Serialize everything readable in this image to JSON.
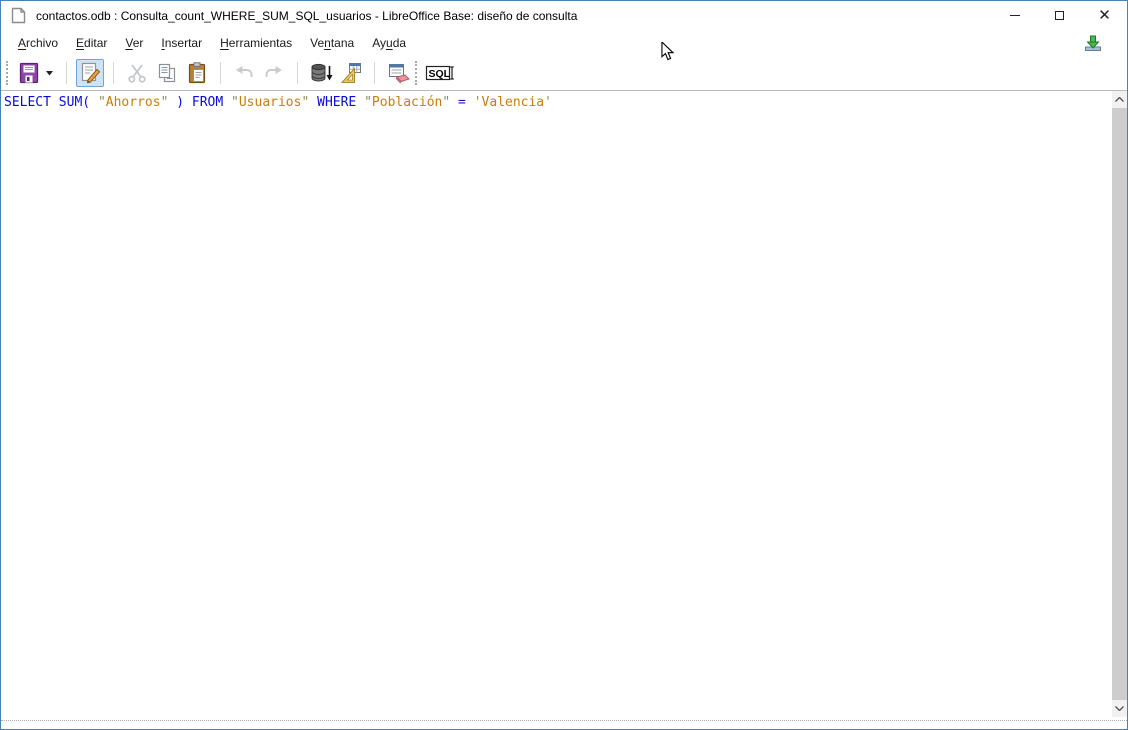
{
  "window": {
    "title": "contactos.odb : Consulta_count_WHERE_SUM_SQL_usuarios - LibreOffice Base: diseño de consulta",
    "app_icon": "libreoffice-document-icon",
    "controls": [
      {
        "id": "minimize",
        "icon": "minimize-icon"
      },
      {
        "id": "maximize",
        "icon": "maximize-icon"
      },
      {
        "id": "close",
        "icon": "close-icon"
      }
    ]
  },
  "menubar": {
    "items": [
      {
        "id": "archivo",
        "label": "Archivo",
        "underline": 0
      },
      {
        "id": "editar",
        "label": "Editar",
        "underline": 0
      },
      {
        "id": "ver",
        "label": "Ver",
        "underline": 0
      },
      {
        "id": "insertar",
        "label": "Insertar",
        "underline": 0
      },
      {
        "id": "herramientas",
        "label": "Herramientas",
        "underline": 0
      },
      {
        "id": "ventana",
        "label": "Ventana",
        "underline": 2
      },
      {
        "id": "ayuda",
        "label": "Ayuda",
        "underline": 2
      }
    ],
    "right_icon": "green-download-tray-icon"
  },
  "toolbar": {
    "buttons": [
      {
        "id": "save",
        "icon": "floppy-disk-icon",
        "state": "enabled"
      },
      {
        "id": "save-dropdown",
        "icon": "chevron-down-icon",
        "state": "enabled"
      },
      {
        "id": "edit-design-toggle",
        "icon": "document-pencil-icon",
        "state": "active"
      },
      {
        "id": "cut",
        "icon": "scissors-icon",
        "state": "disabled"
      },
      {
        "id": "copy",
        "icon": "copy-pages-icon",
        "state": "enabled"
      },
      {
        "id": "paste",
        "icon": "clipboard-paste-icon",
        "state": "enabled"
      },
      {
        "id": "undo",
        "icon": "undo-arrow-icon",
        "state": "disabled"
      },
      {
        "id": "redo",
        "icon": "redo-arrow-icon",
        "state": "disabled"
      },
      {
        "id": "run-query",
        "icon": "database-run-icon",
        "state": "enabled"
      },
      {
        "id": "switch-design-view",
        "icon": "set-square-table-icon",
        "state": "enabled"
      },
      {
        "id": "clear-query",
        "icon": "eraser-window-icon",
        "state": "enabled"
      },
      {
        "id": "run-sql-direct",
        "icon": "sql-icon",
        "state": "enabled"
      }
    ]
  },
  "sql_editor": {
    "statement": "SELECT SUM( \"Ahorros\" ) FROM \"Usuarios\" WHERE \"Población\" = 'Valencia'",
    "tokens": [
      {
        "text": "SELECT",
        "type": "keyword"
      },
      {
        "text": " ",
        "type": "plain"
      },
      {
        "text": "SUM(",
        "type": "keyword"
      },
      {
        "text": " ",
        "type": "plain"
      },
      {
        "text": "\"",
        "type": "quote"
      },
      {
        "text": "Ahorros",
        "type": "identifier"
      },
      {
        "text": "\"",
        "type": "quote"
      },
      {
        "text": " ",
        "type": "plain"
      },
      {
        "text": ")",
        "type": "keyword"
      },
      {
        "text": " ",
        "type": "plain"
      },
      {
        "text": "FROM",
        "type": "keyword"
      },
      {
        "text": " ",
        "type": "plain"
      },
      {
        "text": "\"",
        "type": "quote"
      },
      {
        "text": "Usuarios",
        "type": "identifier"
      },
      {
        "text": "\"",
        "type": "quote"
      },
      {
        "text": " ",
        "type": "plain"
      },
      {
        "text": "WHERE",
        "type": "keyword"
      },
      {
        "text": " ",
        "type": "plain"
      },
      {
        "text": "\"",
        "type": "quote"
      },
      {
        "text": "Población",
        "type": "identifier"
      },
      {
        "text": "\"",
        "type": "quote"
      },
      {
        "text": " ",
        "type": "plain"
      },
      {
        "text": "=",
        "type": "operator"
      },
      {
        "text": " ",
        "type": "plain"
      },
      {
        "text": "'",
        "type": "quote"
      },
      {
        "text": "Valencia",
        "type": "string"
      },
      {
        "text": "'",
        "type": "quote"
      }
    ]
  },
  "colors": {
    "window_border": "#4782b4",
    "keyword": "#0b0bda",
    "operator": "#1414cc",
    "identifier": "#c87e0e",
    "string": "#c87e0e",
    "quote": "#8a8a52",
    "active_button_bg": "#cde3f8",
    "active_button_border": "#74a3d8",
    "scrollbar_track": "#f1f1f1",
    "scrollbar_thumb": "#cdcdcd"
  }
}
